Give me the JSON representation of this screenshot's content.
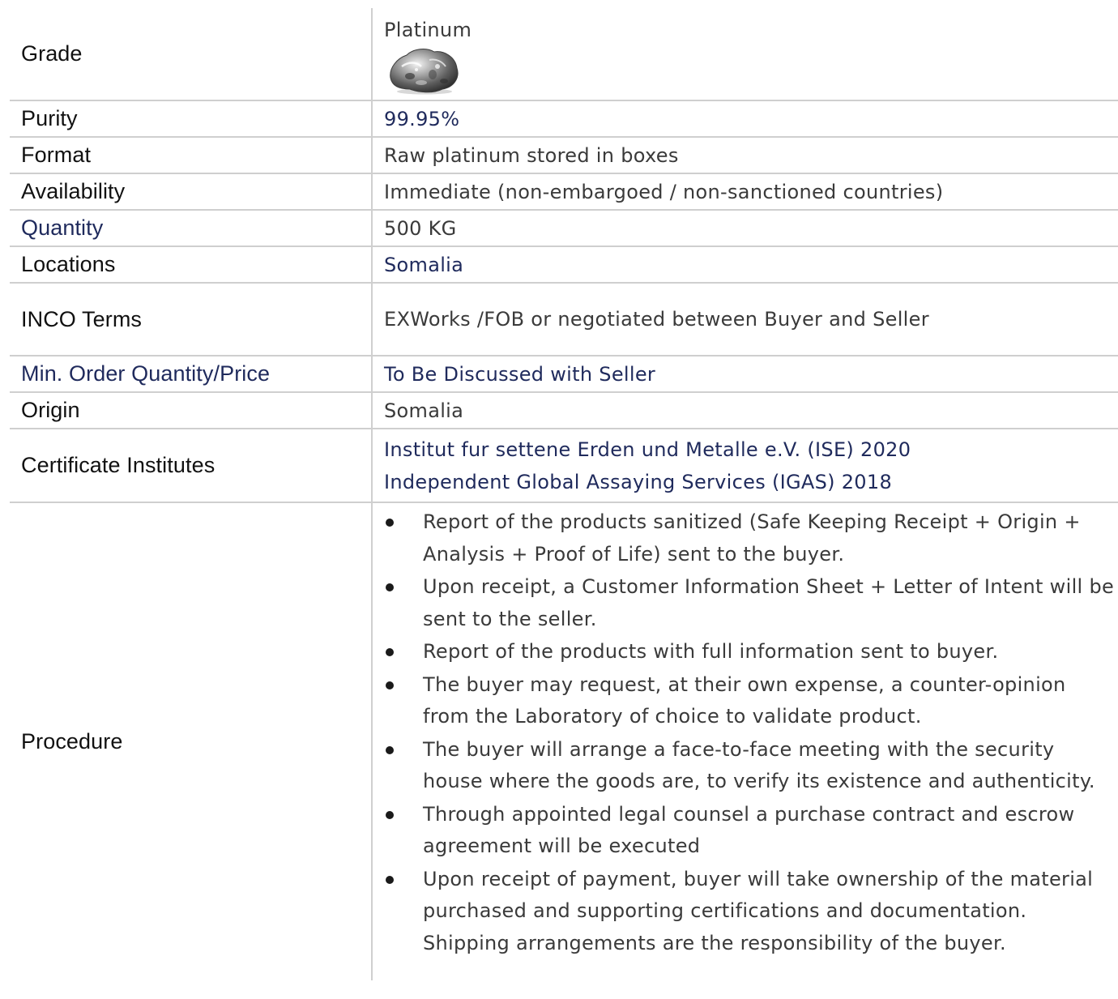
{
  "rows": {
    "grade": {
      "label": "Grade",
      "value": "Platinum",
      "image_icon": "platinum-nugget-icon"
    },
    "purity": {
      "label": "Purity",
      "value": "99.95%"
    },
    "format": {
      "label": "Format",
      "value": "Raw platinum stored in boxes"
    },
    "availability": {
      "label": "Availability",
      "value": "Immediate (non-embargoed / non-sanctioned countries)"
    },
    "quantity": {
      "label": "Quantity",
      "value": "500 KG"
    },
    "locations": {
      "label": "Locations",
      "value": "Somalia"
    },
    "inco_terms": {
      "label": "INCO Terms",
      "value": "EXWorks /FOB or negotiated between Buyer and Seller"
    },
    "min_order": {
      "label": "Min. Order Quantity/Price",
      "value": "To Be Discussed with Seller"
    },
    "origin": {
      "label": "Origin",
      "value": "Somalia"
    },
    "certificates": {
      "label": "Certificate Institutes",
      "lines": [
        "Institut fur settene Erden und Metalle e.V. (ISE) 2020",
        "Independent Global Assaying Services (IGAS) 2018"
      ]
    },
    "procedure": {
      "label": "Procedure",
      "steps": [
        "Report of the products sanitized (Safe Keeping Receipt + Origin + Analysis + Proof of Life) sent to the buyer.",
        "Upon receipt, a Customer Information Sheet + Letter of Intent will be sent to the seller.",
        "Report of the products with full information sent to buyer.",
        "The buyer may request, at their own expense, a counter-opinion from the Laboratory of choice to validate product.",
        "The buyer will arrange a face-to-face meeting with the security house where the goods are, to verify its existence and authenticity.",
        "Through appointed legal counsel a purchase contract and escrow agreement will be executed",
        "Upon receipt of payment, buyer will take ownership of the material purchased and supporting certifications and documentation. Shipping arrangements are the responsibility of the buyer."
      ]
    }
  },
  "colors": {
    "label_text": "#111111",
    "value_text": "#3a3a3a",
    "accent_navy": "#1f2a5c",
    "rule_gray": "#cfcfcf"
  }
}
